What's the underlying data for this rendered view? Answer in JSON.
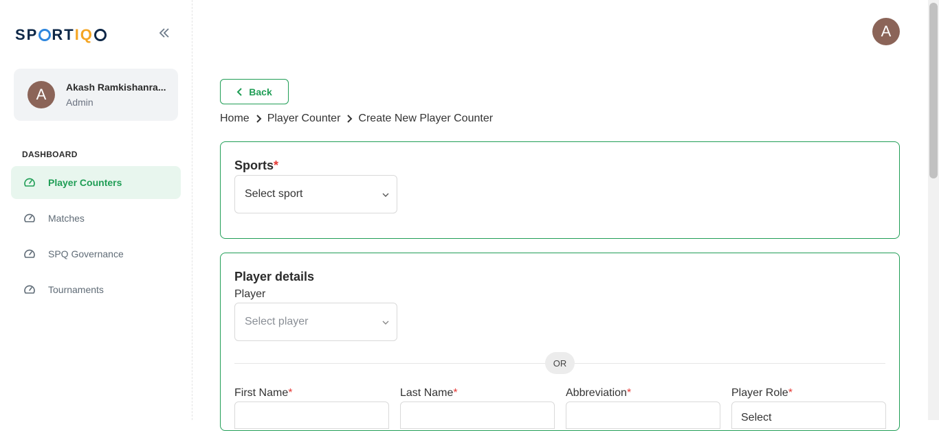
{
  "app": {
    "logo_left": "SP",
    "logo_mid": "RT",
    "logo_iq": "IQ",
    "brand_colors": {
      "accent": "#1f9d55",
      "navy": "#0d2747",
      "blue": "#2e86de",
      "orange": "#f4a523"
    }
  },
  "sidebar": {
    "collapse_icon": "double-chevron-left-icon",
    "user": {
      "initial": "A",
      "name": "Akash Ramkishanra...",
      "role": "Admin"
    },
    "section_title": "DASHBOARD",
    "items": [
      {
        "label": "Player Counters",
        "active": true,
        "icon": "gauge-icon"
      },
      {
        "label": "Matches",
        "active": false,
        "icon": "gauge-icon"
      },
      {
        "label": "SPQ Governance",
        "active": false,
        "icon": "gauge-icon"
      },
      {
        "label": "Tournaments",
        "active": false,
        "icon": "gauge-icon"
      }
    ]
  },
  "header": {
    "avatar_initial": "A"
  },
  "page": {
    "back_label": "Back",
    "breadcrumb": [
      "Home",
      "Player Counter",
      "Create New Player Counter"
    ]
  },
  "sports_card": {
    "title": "Sports",
    "required_mark": "*",
    "select_placeholder": "Select sport"
  },
  "player_card": {
    "title": "Player details",
    "player_label": "Player",
    "player_placeholder": "Select player",
    "or_label": "OR",
    "fields": [
      {
        "label": "First Name",
        "required": "*"
      },
      {
        "label": "Last Name",
        "required": "*"
      },
      {
        "label": "Abbreviation",
        "required": "*"
      },
      {
        "label": "Player Role",
        "required": "*",
        "placeholder": "Select"
      }
    ]
  }
}
